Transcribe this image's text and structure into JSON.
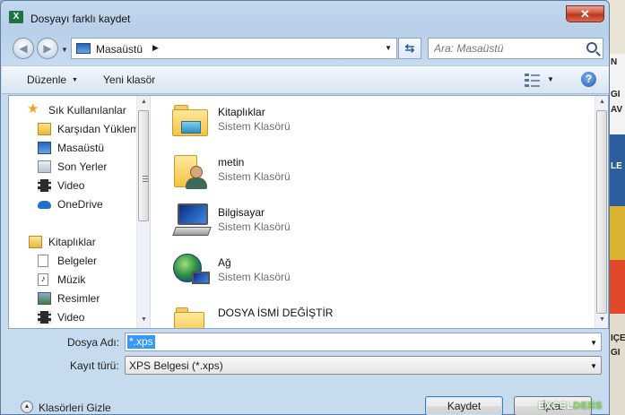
{
  "window": {
    "title": "Dosyayı farklı kaydet",
    "app_icon": "X"
  },
  "navigation": {
    "address": "Masaüstü",
    "search_placeholder": "Ara: Masaüstü"
  },
  "toolbar": {
    "organize_label": "Düzenle",
    "new_folder_label": "Yeni klasör"
  },
  "sidebar": {
    "favorites_header": "Sık Kullanılanlar",
    "favorites": [
      "Karşıdan Yüklem",
      "Masaüstü",
      "Son Yerler",
      "Video",
      "OneDrive"
    ],
    "libraries_header": "Kitaplıklar",
    "libraries": [
      "Belgeler",
      "Müzik",
      "Resimler",
      "Video"
    ]
  },
  "files": [
    {
      "name": "Kitaplıklar",
      "type": "Sistem Klasörü",
      "icon": "library-icon"
    },
    {
      "name": "metin",
      "type": "Sistem Klasörü",
      "icon": "user-folder-icon"
    },
    {
      "name": "Bilgisayar",
      "type": "Sistem Klasörü",
      "icon": "computer-icon"
    },
    {
      "name": "Ağ",
      "type": "Sistem Klasörü",
      "icon": "network-icon"
    },
    {
      "name": "DOSYA İSMİ DEĞİŞTİR",
      "type": "",
      "icon": "folder-icon"
    }
  ],
  "form": {
    "filename_label": "Dosya Adı:",
    "filename_value": "*.xps",
    "filetype_label": "Kayıt türü:",
    "filetype_value": "XPS Belgesi (*.xps)"
  },
  "footer": {
    "hide_folders_label": "Klasörleri Gizle",
    "save_label": "Kaydet",
    "cancel_label": "İptal"
  },
  "watermark": {
    "left": "EXCEL",
    "right": "DERS"
  },
  "background_fragments": [
    "N",
    "N",
    "GI",
    "AV",
    "LE",
    "IÇE",
    "GI"
  ],
  "colors": {
    "accent": "#3399ff",
    "close": "#c8432a",
    "window": "#c3d8ee"
  }
}
